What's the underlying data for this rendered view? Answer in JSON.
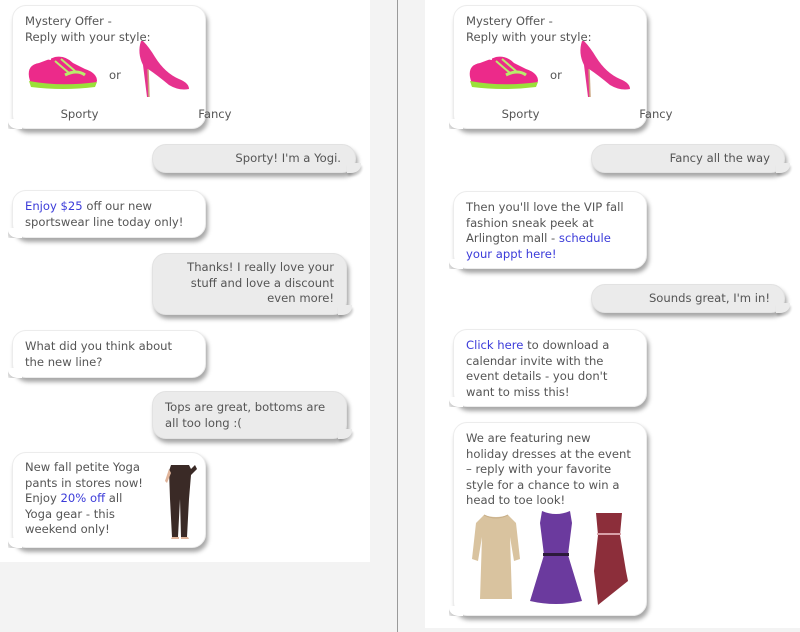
{
  "left_conversation": {
    "messages": [
      {
        "from": "brand",
        "type": "offer",
        "title_line1": "Mystery Offer -",
        "title_line2": "Reply with your style:",
        "option_a": "Sporty",
        "option_b": "Fancy",
        "separator": "or",
        "icon_a": "sneaker-image",
        "icon_b": "high-heel-image"
      },
      {
        "from": "customer",
        "text": "Sporty! I'm a Yogi."
      },
      {
        "from": "brand",
        "link": "Enjoy $25",
        "text": " off our new sportswear line today only!"
      },
      {
        "from": "customer",
        "text": "Thanks! I really love your stuff and love a discount even more!"
      },
      {
        "from": "brand",
        "text": "What did you think about the new line?"
      },
      {
        "from": "customer",
        "text": "Tops are great, bottoms are all too long :("
      },
      {
        "from": "brand",
        "text_before": "New fall petite Yoga pants in stores now! Enjoy ",
        "link": "20% off",
        "text_after": " all Yoga gear - this weekend only!",
        "image": "yoga-pants-image"
      }
    ]
  },
  "right_conversation": {
    "messages": [
      {
        "from": "brand",
        "type": "offer",
        "title_line1": "Mystery Offer -",
        "title_line2": "Reply with your style:",
        "option_a": "Sporty",
        "option_b": "Fancy",
        "separator": "or",
        "icon_a": "sneaker-image",
        "icon_b": "high-heel-image"
      },
      {
        "from": "customer",
        "text": "Fancy all the way"
      },
      {
        "from": "brand",
        "text": "Then you'll love the VIP fall fashion sneak peek at Arlington mall - ",
        "link": "schedule your appt here!"
      },
      {
        "from": "customer",
        "text": "Sounds great, I'm in!"
      },
      {
        "from": "brand",
        "link": "Click here",
        "text": " to download a calendar invite with the event details - you don't want to miss this!"
      },
      {
        "from": "brand",
        "text": "We are featuring new holiday dresses at the event – reply with your favorite style for a chance to win a head to toe look!",
        "images": [
          "gold-sequin-dress-image",
          "purple-dress-image",
          "burgundy-dress-image"
        ]
      }
    ]
  },
  "colors": {
    "link": "#3b3bd9",
    "incoming_bubble": "#ffffff",
    "outgoing_bubble": "#ebebeb",
    "text": "#555555",
    "background": "#f3f3f3"
  }
}
